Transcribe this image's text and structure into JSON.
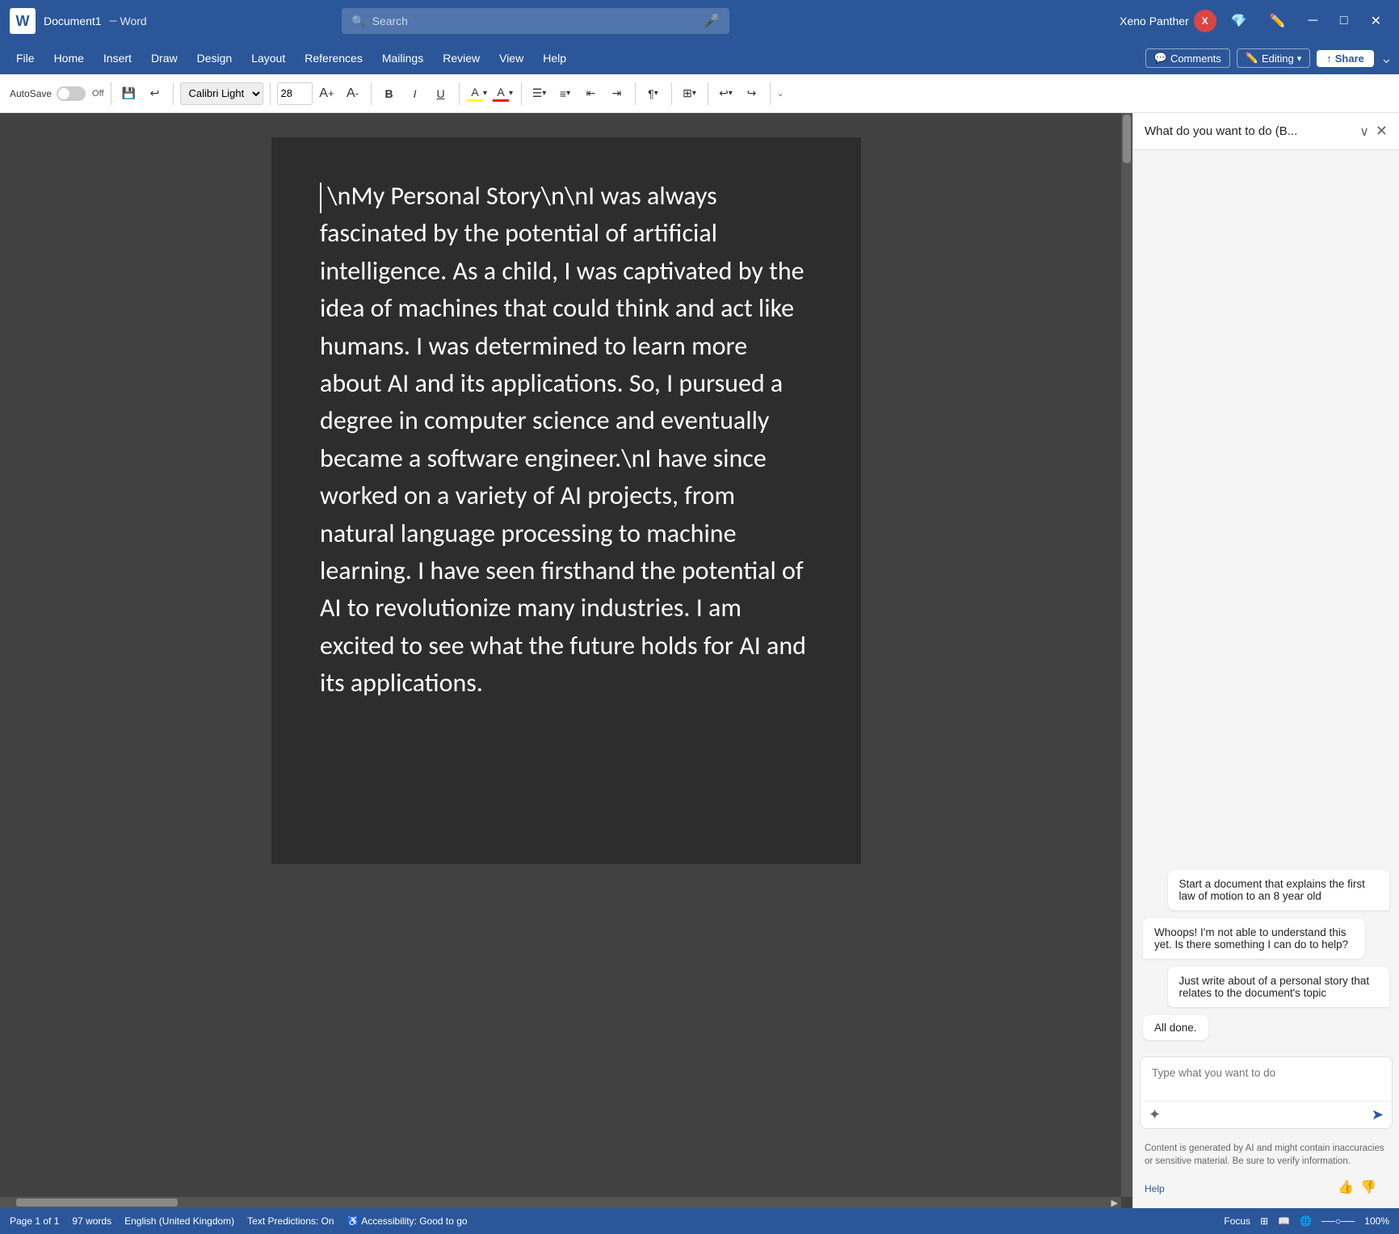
{
  "titlebar": {
    "word_initial": "W",
    "filename": "Document1",
    "separator": "–",
    "app_name": "Word",
    "search_placeholder": "Search",
    "user_name": "Xeno Panther",
    "user_initial": "X",
    "mic_icon": "🎤"
  },
  "menubar": {
    "items": [
      "File",
      "Home",
      "Insert",
      "Draw",
      "Design",
      "Layout",
      "References",
      "Mailings",
      "Review",
      "View",
      "Help"
    ],
    "comments_label": "Comments",
    "editing_label": "Editing",
    "share_label": "Share"
  },
  "toolbar": {
    "autosave_label": "AutoSave",
    "toggle_off_label": "Off",
    "font_name": "Calibri Light (",
    "font_size": "28",
    "bold": "B",
    "italic": "I",
    "underline": "U"
  },
  "panel": {
    "title": "What do you want to do (B...",
    "close_icon": "✕",
    "chevron_icon": "∨"
  },
  "chat": {
    "message1": "Start a document that explains the first law of motion to an 8 year old",
    "message2": "Whoops! I'm not able to understand this yet. Is there something I can do to help?",
    "message3": "Just write about of a personal story that relates to the document's topic",
    "message4": "All done.",
    "input_placeholder": "Type what you want to do",
    "disclaimer": "Content is generated by AI and might contain inaccuracies or sensitive material. Be sure to verify information.",
    "help_label": "Help"
  },
  "document": {
    "content": "\\nMy Personal Story\\n\\nI was always fascinated by the potential of artificial intelligence. As a child, I was captivated by the idea of machines that could think and act like humans. I was determined to learn more about AI and its applications. So, I pursued a degree in computer science and eventually became a software engineer.\\nI have since worked on a variety of AI projects, from natural language processing to machine learning. I have seen firsthand the potential of AI to revolutionize many industries. I am excited to see what the future holds for AI and its applications."
  },
  "statusbar": {
    "page_info": "Page 1 of 1",
    "words": "97 words",
    "language": "English (United Kingdom)",
    "predictions": "Text Predictions: On",
    "accessibility": "Accessibility: Good to go",
    "focus": "Focus",
    "zoom": "100%"
  }
}
